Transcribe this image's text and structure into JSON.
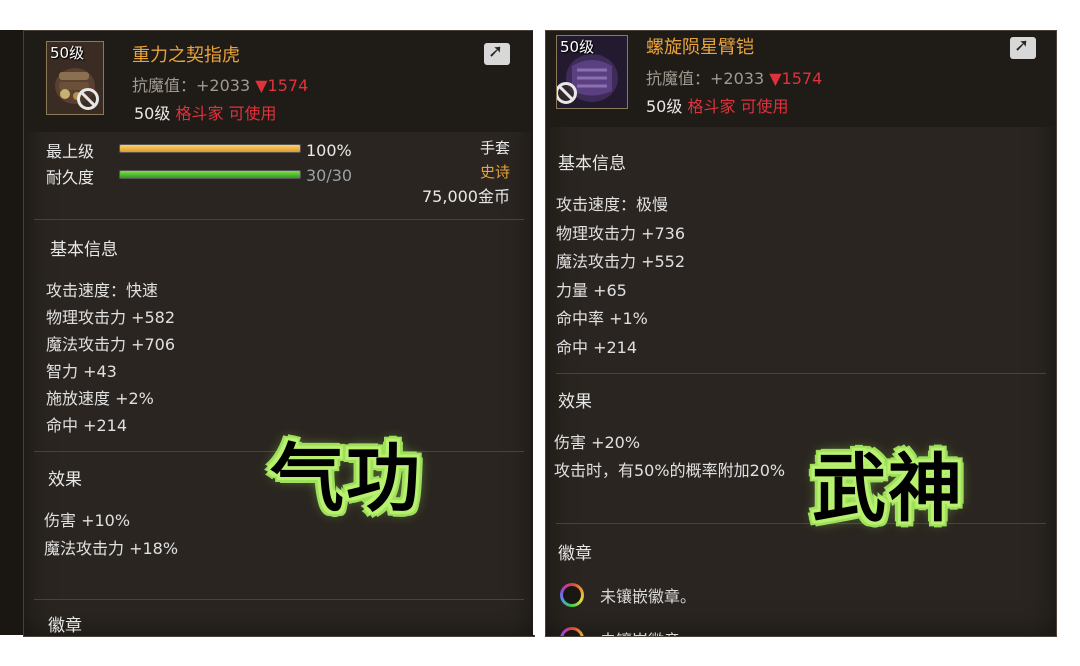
{
  "left": {
    "level_badge": "50级",
    "item_name": "重力之契指虎",
    "resist_label": "抗魔值：+2033",
    "resist_diff": "▼1574",
    "req_level": "50级",
    "req_class": "格斗家 可使用",
    "bars": [
      {
        "label": "最上级",
        "value": "100%",
        "fill": 1.0,
        "color": "gold"
      },
      {
        "label": "耐久度",
        "value": "30/30",
        "fill": 1.0,
        "color": "green"
      }
    ],
    "slot": "手套",
    "rarity": "史诗",
    "price": "75,000金币",
    "basic_title": "基本信息",
    "basic_stats": [
      "攻击速度：快速",
      "物理攻击力 +582",
      "魔法攻击力 +706",
      "智力 +43",
      "施放速度 +2%",
      "命中 +214"
    ],
    "effect_title": "效果",
    "effects": [
      "伤害 +10%",
      "魔法攻击力 +18%"
    ],
    "emblem_title": "徽章",
    "sticker": "气功"
  },
  "right": {
    "level_badge": "50级",
    "item_name": "螺旋陨星臂铠",
    "resist_label": "抗魔值：+2033",
    "resist_diff": "▼1574",
    "req_level": "50级",
    "req_class": "格斗家 可使用",
    "basic_title": "基本信息",
    "basic_stats": [
      "攻击速度：极慢",
      "物理攻击力 +736",
      "魔法攻击力 +552",
      "力量 +65",
      "命中率 +1%",
      "命中 +214"
    ],
    "effect_title": "效果",
    "effects": [
      "伤害 +20%",
      "攻击时，有50%的概率附加20%"
    ],
    "emblem_title": "徽章",
    "emblems": [
      "未镶嵌徽章。",
      "未镶嵌徽章"
    ],
    "sticker": "武神"
  },
  "icons": {
    "share": "share-icon",
    "no_use": "prohibited-icon",
    "emblem_socket": "emblem-socket-icon"
  },
  "colors": {
    "item_name": "#e8a33c",
    "down_arrow": "#e0323c",
    "class_restriction": "#e0323c",
    "epic": "#e8a33c",
    "sticker_outline": "#9ee05a"
  }
}
